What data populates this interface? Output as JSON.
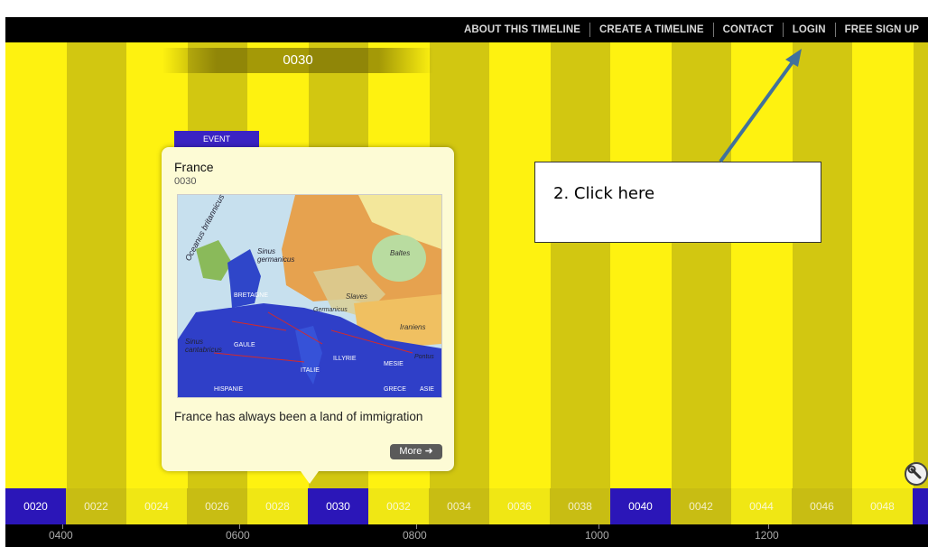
{
  "nav": {
    "items": [
      "ABOUT THIS TIMELINE",
      "CREATE A TIMELINE",
      "CONTACT",
      "LOGIN",
      "FREE SIGN UP"
    ]
  },
  "timeline": {
    "current_year": "0030",
    "scale_labels": [
      "0020",
      "0022",
      "0024",
      "0026",
      "0028",
      "0030",
      "0032",
      "0034",
      "0036",
      "0038",
      "0040",
      "0042",
      "0044",
      "0046",
      "0048",
      ""
    ],
    "highlighted_labels": [
      "0020",
      "0030",
      "0040"
    ],
    "bottom_labels": [
      "0400",
      "0600",
      "0800",
      "1000",
      "1200"
    ]
  },
  "event": {
    "tag": "EVENT",
    "title": "France",
    "date": "0030",
    "description": "France has always been a land of immigration",
    "more_label": "More",
    "map_labels": [
      "Oceanus britannicus",
      "Sinus germanicus",
      "Baltes",
      "Slaves",
      "Iraniens",
      "Germanicus",
      "Sinus cantabricus",
      "GAULE",
      "ITALIE",
      "ILLYRIE",
      "MESIE",
      "Pontus",
      "ASIE",
      "GRECE",
      "HISPANIE",
      "BRETAGNE"
    ]
  },
  "callout": {
    "text": "2. Click here"
  },
  "colors": {
    "stripe_light": "#fef210",
    "stripe_dark": "#d2c711",
    "accent_blue": "#2b16b8",
    "arrow": "#41719c"
  },
  "icons": {
    "settings": "wrench-icon",
    "more": "arrow-right-icon"
  }
}
